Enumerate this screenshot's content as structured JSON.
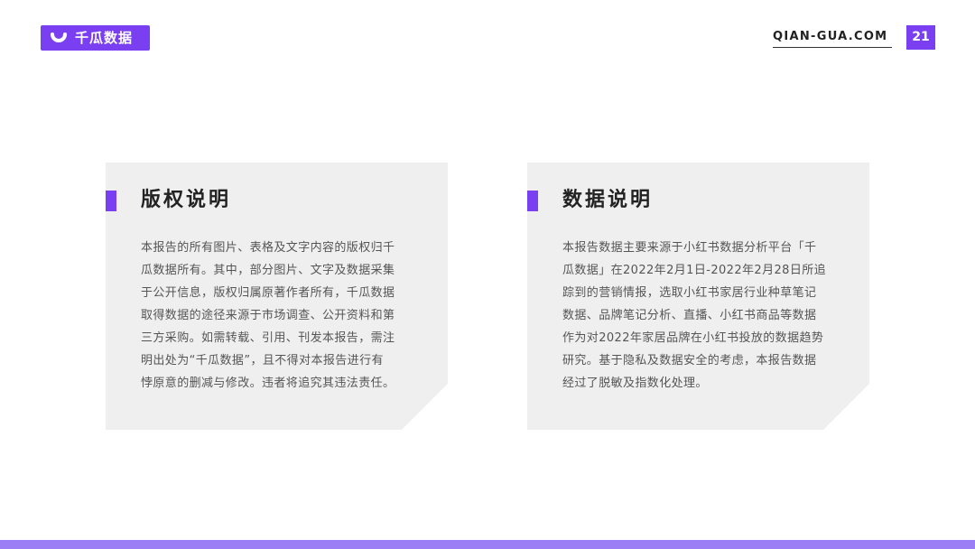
{
  "header": {
    "logo_text": "千瓜数据",
    "site": "QIAN-GUA.COM",
    "page_number": "21"
  },
  "sections": [
    {
      "title": "版权说明",
      "lines": [
        "本报告的所有图片、表格及文字内容的版权归千",
        "瓜数据所有。其中，部分图片、文字及数据采集",
        "于公开信息，版权归属原著作者所有，千瓜数据",
        "取得数据的途径来源于市场调查、公开资料和第",
        "三方采购。如需转载、引用、刊发本报告，需注",
        "明出处为“千瓜数据”，且不得对本报告进行有",
        "悖原意的删减与修改。违者将追究其违法责任。"
      ]
    },
    {
      "title": "数据说明",
      "lines": [
        "本报告数据主要来源于小红书数据分析平台「千",
        "瓜数据」在2022年2月1日-2022年2月28日所追",
        "踪到的营销情报，选取小红书家居行业种草笔记",
        "数据、品牌笔记分析、直播、小红书商品等数据",
        "作为对2022年家居品牌在小红书投放的数据趋势",
        "研究。基于隐私及数据安全的考虑，本报告数据",
        "经过了脱敏及指数化处理。"
      ]
    }
  ],
  "colors": {
    "accent": "#7b3ff2",
    "bottom_bar": "#9b7ef5",
    "card_bg": "#efefef"
  }
}
